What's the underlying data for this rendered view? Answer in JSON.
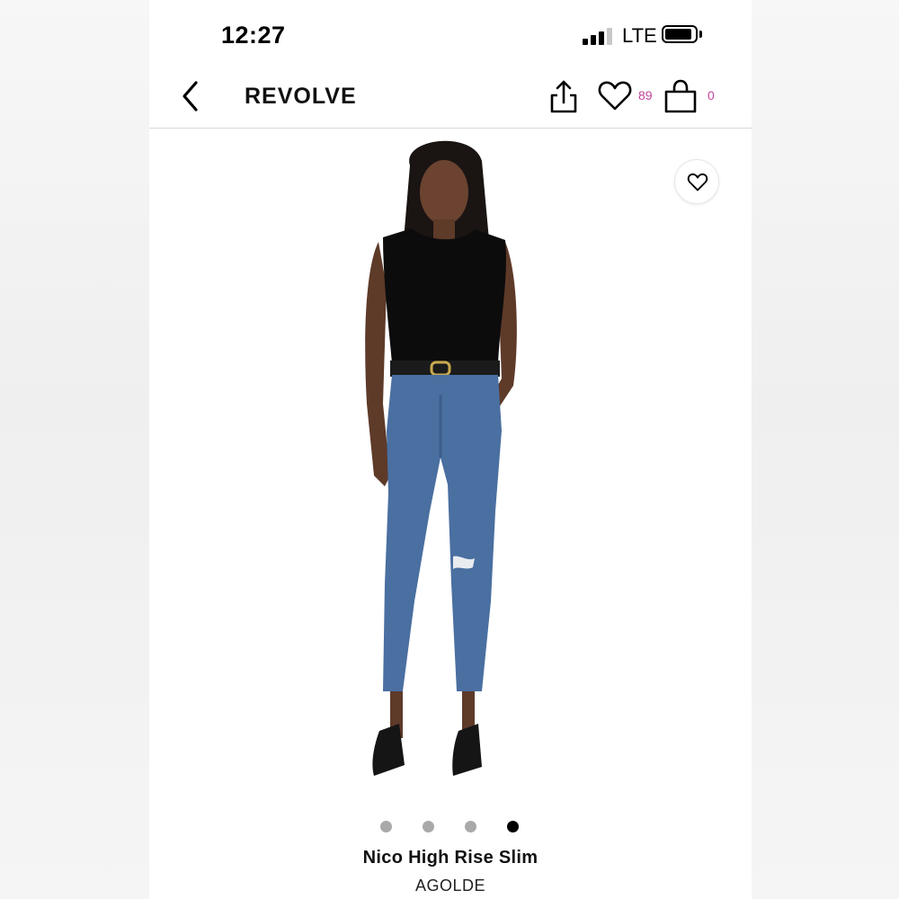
{
  "status_bar": {
    "time": "12:27",
    "network": "LTE"
  },
  "nav": {
    "brand": "REVOLVE",
    "wishlist_count": "89",
    "bag_count": "0",
    "accent_color": "#c2449a"
  },
  "product": {
    "name": "Nico High Rise Slim",
    "brand": "AGOLDE",
    "image_count": 4,
    "active_image_index": 4
  },
  "icons": {
    "back": "chevron-left-icon",
    "share": "share-icon",
    "wishlist": "heart-icon",
    "bag": "shopping-bag-icon",
    "favorite": "heart-icon"
  }
}
